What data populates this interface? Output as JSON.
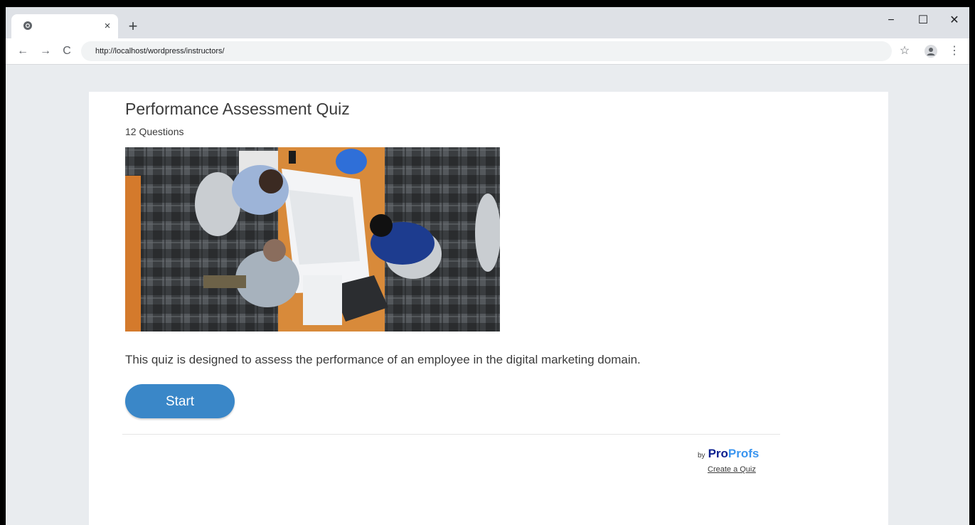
{
  "browser": {
    "tab": {
      "close_glyph": "×"
    },
    "new_tab_glyph": "+",
    "window_controls": {
      "minimize": "−",
      "maximize": "☐",
      "close": "✕"
    },
    "nav": {
      "back": "←",
      "forward": "→",
      "reload": "C"
    },
    "url": "http://localhost/wordpress/instructors/",
    "toolbar_right": {
      "bookmark": "☆",
      "menu": "⋮"
    }
  },
  "quiz": {
    "title": "Performance Assessment Quiz",
    "question_count": "12 Questions",
    "description": "This quiz is designed to assess the performance of an employee in the digital marketing domain.",
    "start_label": "Start"
  },
  "footer": {
    "by": "by",
    "brand_pro": "Pro",
    "brand_profs": "Profs",
    "create_link": "Create a Quiz"
  },
  "colors": {
    "start_button": "#3a87c8",
    "brand_dark": "#0b1f8f",
    "brand_light": "#3a95f0"
  }
}
